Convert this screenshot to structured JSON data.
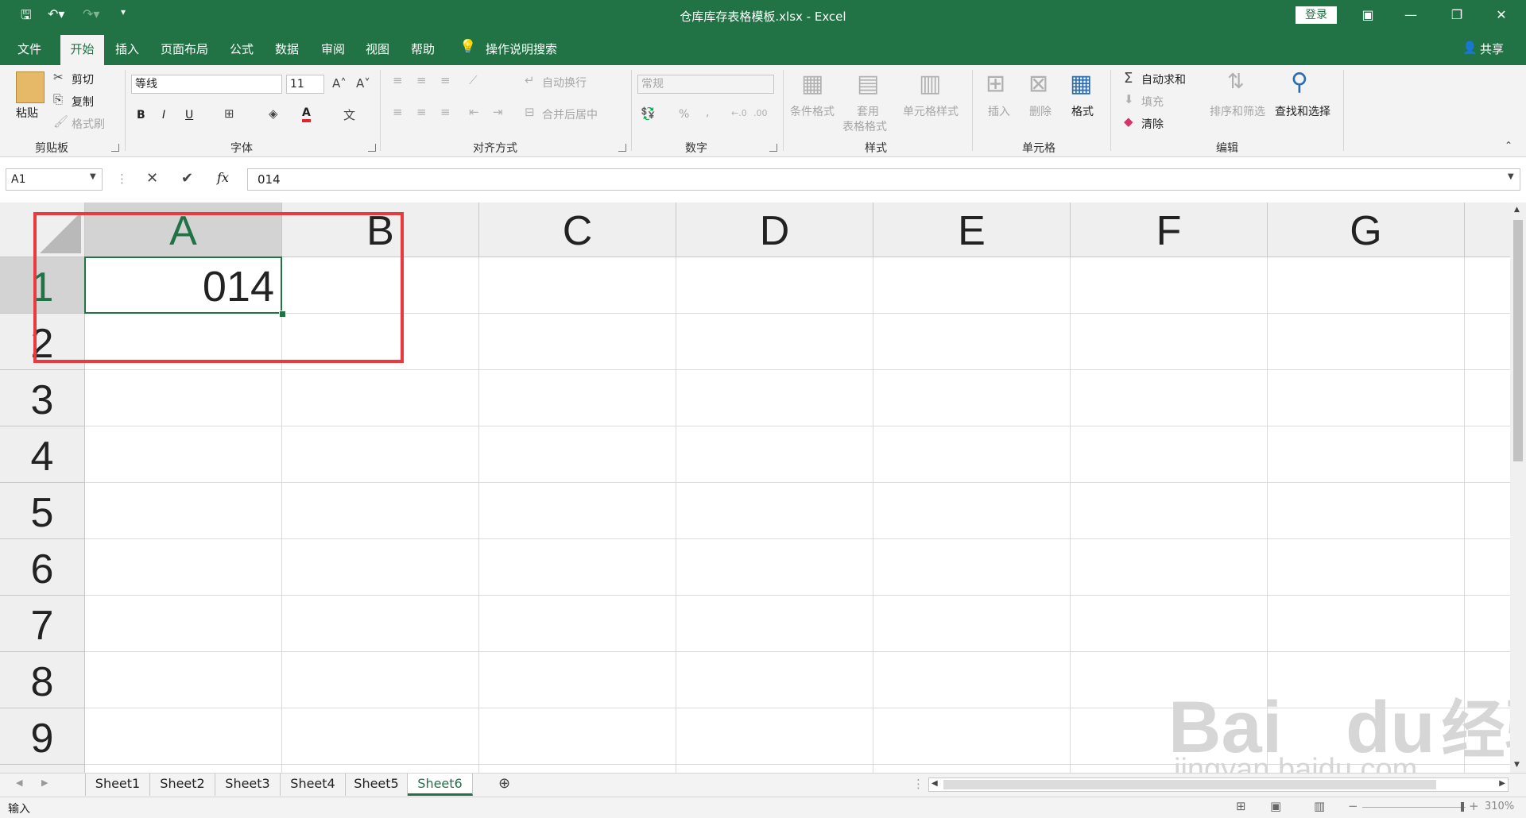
{
  "window": {
    "title": "仓库库存表格模板.xlsx  -  Excel",
    "login_label": "登录",
    "share_label": "共享"
  },
  "menu": {
    "file": "文件",
    "home": "开始",
    "insert": "插入",
    "page_layout": "页面布局",
    "formulas": "公式",
    "data": "数据",
    "review": "审阅",
    "view": "视图",
    "help": "帮助",
    "tell_me": "操作说明搜索"
  },
  "ribbon": {
    "clipboard": {
      "label": "剪贴板",
      "paste": "粘贴",
      "cut": "剪切",
      "copy": "复制",
      "format_painter": "格式刷"
    },
    "font": {
      "label": "字体",
      "font_name": "等线",
      "font_size": "11",
      "bold": "B",
      "italic": "I",
      "underline": "U",
      "font_color": "A"
    },
    "alignment": {
      "label": "对齐方式",
      "wrap": "自动换行",
      "merge": "合并后居中"
    },
    "number": {
      "label": "数字",
      "format": "常规",
      "percent": "%",
      "comma": ","
    },
    "styles": {
      "label": "样式",
      "conditional": "条件格式",
      "table_style_1": "套用",
      "table_style_2": "表格格式",
      "cell_style": "单元格样式"
    },
    "cells": {
      "label": "单元格",
      "insert": "插入",
      "delete": "删除",
      "format": "格式"
    },
    "editing": {
      "label": "编辑",
      "autosum": "自动求和",
      "fill": "填充",
      "clear": "清除",
      "sort": "排序和筛选",
      "find": "查找和选择"
    }
  },
  "formula_bar": {
    "name_box": "A1",
    "fx": "fx",
    "content": "014"
  },
  "sheet": {
    "columns": [
      "A",
      "B",
      "C",
      "D",
      "E",
      "F",
      "G"
    ],
    "rows": [
      "1",
      "2",
      "3",
      "4",
      "5",
      "6",
      "7",
      "8",
      "9"
    ],
    "cell_a1": "014"
  },
  "sheet_tabs": [
    "Sheet1",
    "Sheet2",
    "Sheet3",
    "Sheet4",
    "Sheet5",
    "Sheet6"
  ],
  "active_sheet": "Sheet6",
  "status": {
    "mode": "输入",
    "zoom": "310%"
  },
  "watermark": {
    "brand": "Bai",
    "brand2": "du",
    "cn": "经验",
    "url": "jingyan.baidu.com"
  },
  "colors": {
    "excel_green": "#217346",
    "highlight_red": "#ea3a3f"
  }
}
